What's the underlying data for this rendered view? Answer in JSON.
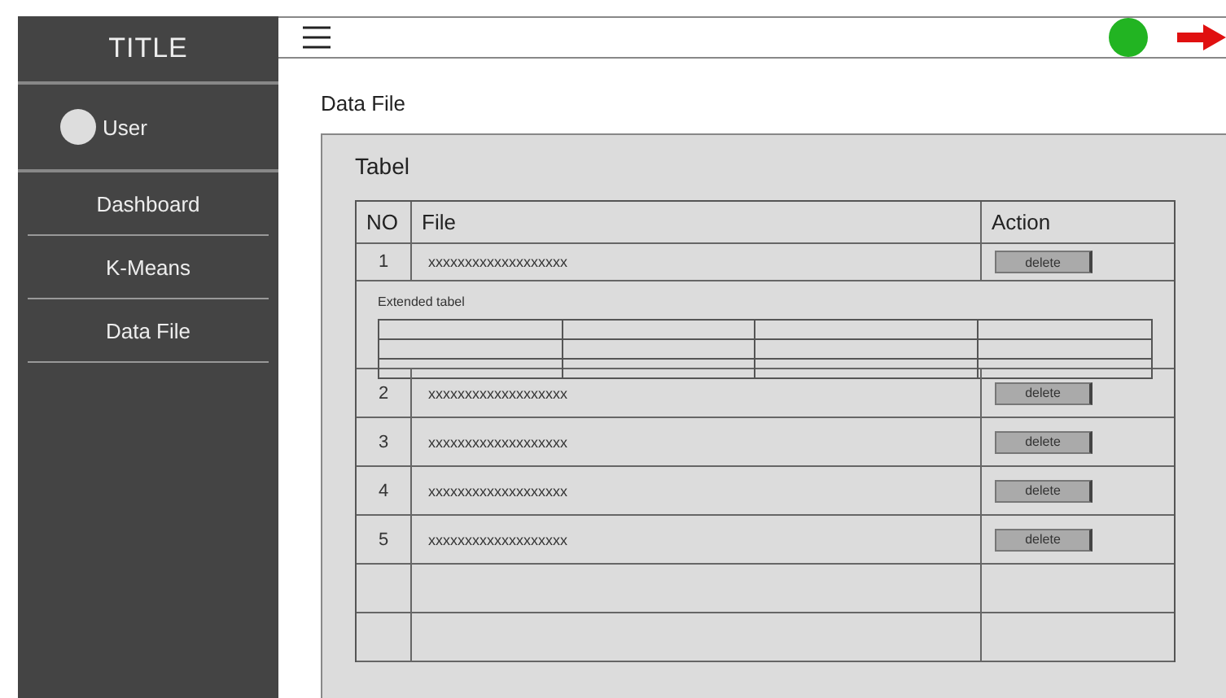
{
  "sidebar": {
    "title": "TITLE",
    "user": {
      "name": "User"
    },
    "items": [
      {
        "label": "Dashboard"
      },
      {
        "label": "K-Means"
      },
      {
        "label": "Data File"
      }
    ]
  },
  "page": {
    "heading": "Data File"
  },
  "card": {
    "title": "Tabel",
    "table": {
      "columns": [
        "NO",
        "File",
        "Action"
      ],
      "rows": [
        {
          "no": "1",
          "file": "xxxxxxxxxxxxxxxxxxx",
          "action": "delete",
          "extended": {
            "title": "Extended tabel"
          }
        },
        {
          "no": "2",
          "file": "xxxxxxxxxxxxxxxxxxx",
          "action": "delete"
        },
        {
          "no": "3",
          "file": "xxxxxxxxxxxxxxxxxxx",
          "action": "delete"
        },
        {
          "no": "4",
          "file": "xxxxxxxxxxxxxxxxxxx",
          "action": "delete"
        },
        {
          "no": "5",
          "file": "xxxxxxxxxxxxxxxxxxx",
          "action": "delete"
        }
      ]
    }
  }
}
